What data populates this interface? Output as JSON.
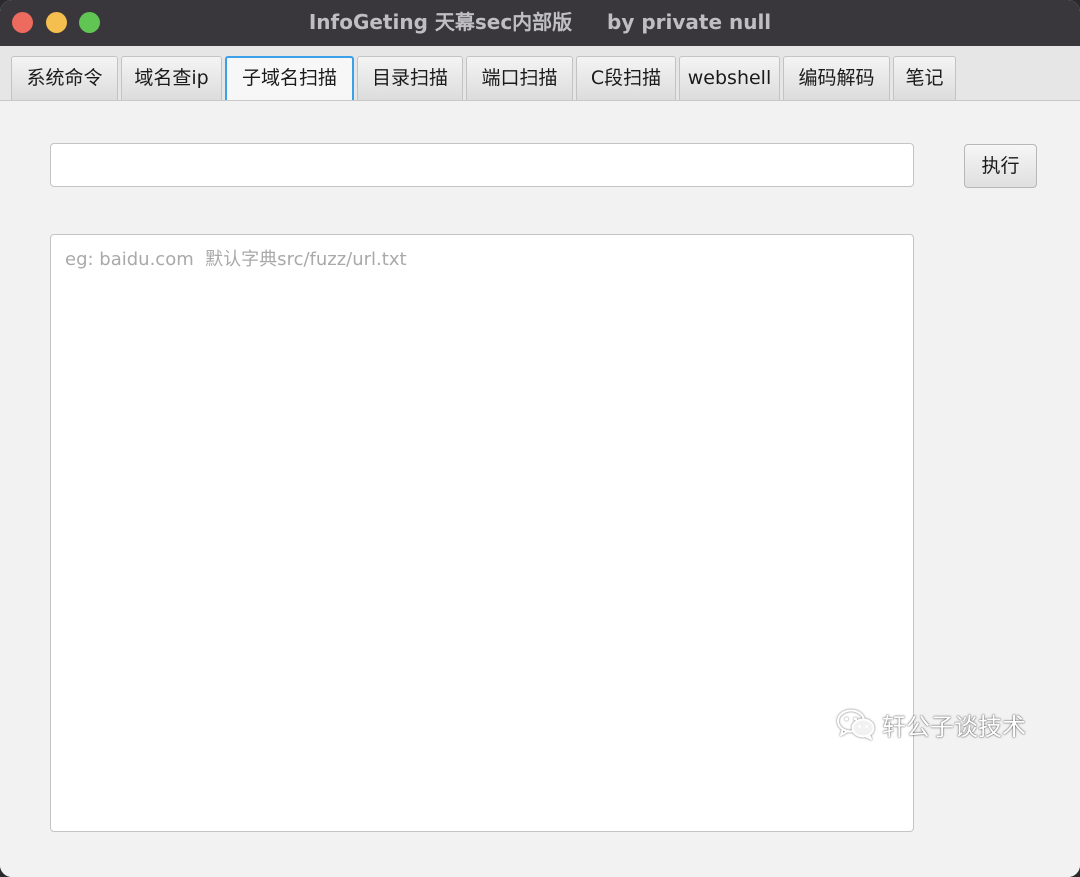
{
  "window": {
    "title": "InfoGeting 天幕sec内部版     by private null",
    "colors": {
      "titlebar": "#39373b",
      "close": "#ed6a5e",
      "minimize": "#f5bf4f",
      "maximize": "#61c554",
      "active_tab_border": "#3aa0e8"
    }
  },
  "tabs": [
    {
      "label": "系统命令",
      "active": false
    },
    {
      "label": "域名查ip",
      "active": false
    },
    {
      "label": "子域名扫描",
      "active": true
    },
    {
      "label": "目录扫描",
      "active": false
    },
    {
      "label": "端口扫描",
      "active": false
    },
    {
      "label": "C段扫描",
      "active": false
    },
    {
      "label": "webshell",
      "active": false
    },
    {
      "label": "编码解码",
      "active": false
    },
    {
      "label": "笔记",
      "active": false
    }
  ],
  "form": {
    "target_value": "",
    "execute_label": "执行"
  },
  "output": {
    "value": "",
    "placeholder": "eg: baidu.com  默认字典src/fuzz/url.txt"
  },
  "watermark": {
    "icon": "wechat-icon",
    "text": "轩公子谈技术"
  }
}
